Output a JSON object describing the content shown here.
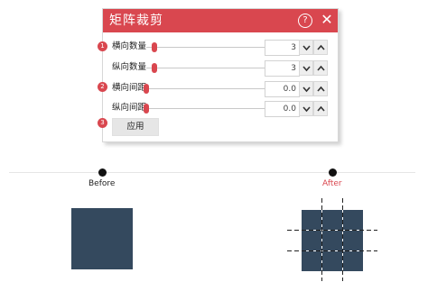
{
  "dialog": {
    "title": "矩阵裁剪",
    "help_icon": "?",
    "close_icon": "✕",
    "rows": [
      {
        "step": "1",
        "label": "横向数量",
        "value": "3",
        "slider_fraction": 0.04
      },
      {
        "step": "",
        "label": "纵向数量",
        "value": "3",
        "slider_fraction": 0.04
      },
      {
        "step": "2",
        "label": "横向间距",
        "value": "0.0",
        "slider_fraction": 0.0
      },
      {
        "step": "",
        "label": "纵向间距",
        "value": "0.0",
        "slider_fraction": 0.0
      }
    ],
    "apply_step": "3",
    "apply_label": "应用"
  },
  "illustration": {
    "before_label": "Before",
    "after_label": "After",
    "square_color": "#34495e",
    "accent_color": "#d9474f",
    "grid_rows": 3,
    "grid_cols": 3
  }
}
